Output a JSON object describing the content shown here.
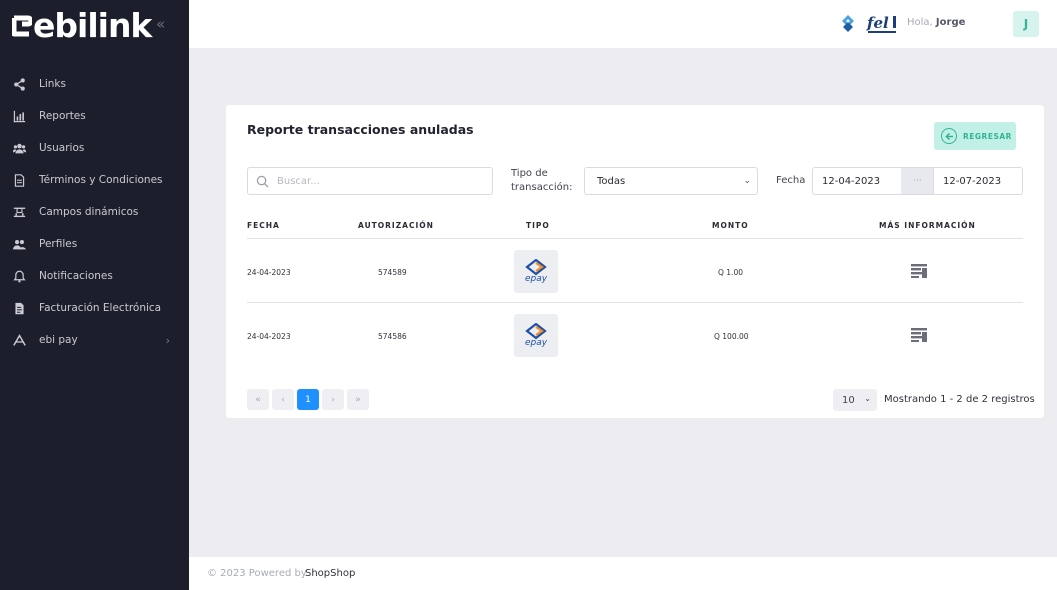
{
  "brand": {
    "name": "ebilink"
  },
  "sidebar": {
    "items": [
      {
        "label": "Links",
        "icon": "share-icon"
      },
      {
        "label": "Reportes",
        "icon": "bar-chart-icon"
      },
      {
        "label": "Usuarios",
        "icon": "users-icon"
      },
      {
        "label": "Términos y Condiciones",
        "icon": "document-icon"
      },
      {
        "label": "Campos dinámicos",
        "icon": "fields-icon"
      },
      {
        "label": "Perfiles",
        "icon": "profiles-icon"
      },
      {
        "label": "Notificaciones",
        "icon": "bell-icon"
      },
      {
        "label": "Facturación Electrónica",
        "icon": "invoice-icon"
      },
      {
        "label": "ebi pay",
        "icon": "ebipay-icon"
      }
    ]
  },
  "header": {
    "greeting": "Hola,",
    "user_name": "Jorge",
    "avatar_initial": "J"
  },
  "report": {
    "title": "Reporte transacciones anuladas",
    "back_label": "REGRESAR",
    "search_placeholder": "Buscar...",
    "tipo_label": "Tipo de transacción:",
    "tipo_value": "Todas",
    "fecha_label": "Fecha",
    "date_from": "12-04-2023",
    "date_sep": "···",
    "date_to": "12-07-2023",
    "columns": [
      "FECHA",
      "AUTORIZACIÓN",
      "TIPO",
      "MONTO",
      "MÁS INFORMACIÓN"
    ],
    "rows": [
      {
        "fecha": "24-04-2023",
        "autorizacion": "574589",
        "tipo": "epay",
        "monto": "Q 1.00"
      },
      {
        "fecha": "24-04-2023",
        "autorizacion": "574586",
        "tipo": "epay",
        "monto": "Q 100.00"
      }
    ],
    "pagination": {
      "first": "«",
      "prev": "‹",
      "current": "1",
      "next": "›",
      "last": "»",
      "per_page": "10",
      "showing": "Mostrando 1 - 2 de 2 registros"
    }
  },
  "footer": {
    "copyright": "© 2023 Powered by",
    "link": "ShopShop"
  },
  "colors": {
    "sidebar_bg": "#1d1e2c",
    "accent_green": "#2fb594",
    "accent_blue": "#1e90ff",
    "page_bg": "#ececf1"
  }
}
